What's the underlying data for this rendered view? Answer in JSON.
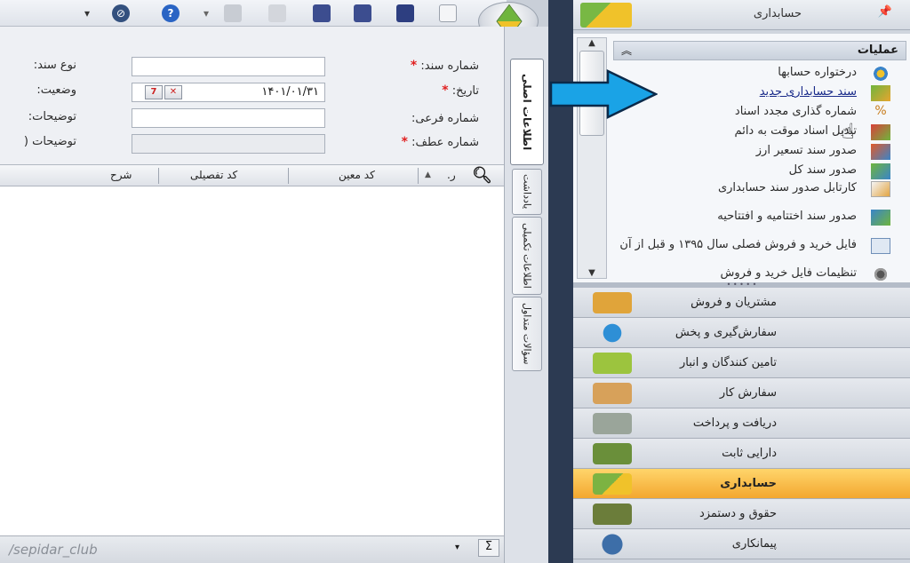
{
  "form": {
    "doc_number_label": "شماره سند:",
    "doc_type_label": "نوع سند:",
    "date_label": "تاریخ:",
    "date_value": "۱۴۰۱/۰۱/۳۱",
    "status_label": "وضعیت:",
    "sub_number_label": "شماره فرعی:",
    "desc_label": "توضیحات:",
    "ref_number_label": "شماره عطف:",
    "desc2_label": "توضیحات (",
    "calendar_icon_text": "7",
    "clear_icon_text": "✕",
    "required_mark": "*"
  },
  "grid": {
    "columns": [
      "ر.",
      "کد معین",
      "کد تفصیلی",
      "شرح"
    ],
    "sort_arrow": "▲"
  },
  "vtabs": [
    {
      "label": "اطلاعات اصلی"
    },
    {
      "label": "یادداشت"
    },
    {
      "label": "اطلاعات تکمیلی"
    },
    {
      "label": "سؤالات متداول"
    }
  ],
  "statusbar": {
    "watermark": "/sepidar_club"
  },
  "right_panel": {
    "title": "حسابداری",
    "pin": "📌",
    "operations_title": "عملیات",
    "collapse": "«",
    "operations": [
      {
        "label": "درختواره حسابها",
        "icon": "tree-icon"
      },
      {
        "label": "سند حسابداری جدید",
        "icon": "new-voucher-icon"
      },
      {
        "label": "شماره گذاری مجدد اسناد",
        "icon": "renumber-icon"
      },
      {
        "label": "تبدیل اسناد موقت به دائم",
        "icon": "convert-icon"
      },
      {
        "label": "صدور سند تسعیر ارز",
        "icon": "currency-icon"
      },
      {
        "label": "صدور سند کل",
        "icon": "gl-icon"
      },
      {
        "label": "کارتابل صدور سند حسابداری",
        "icon": "cartable-icon"
      },
      {
        "label": "صدور سند اختتامیه و افتتاحیه",
        "icon": "closing-icon"
      },
      {
        "label": "فایل خرید و فروش فصلی سال ۱۳۹۵ و قبل از آن",
        "icon": "file-icon"
      },
      {
        "label": "تنظیمات فایل خرید و فروش",
        "icon": "settings-icon"
      }
    ],
    "modules": [
      {
        "label": "مشتریان و فروش",
        "color": "#e0a43a"
      },
      {
        "label": "سفارش‌گیری و پخش",
        "color": "#2e8fd6"
      },
      {
        "label": "تامین کنندگان و انبار",
        "color": "#9cc43e"
      },
      {
        "label": "سفارش کار",
        "color": "#d7a15a"
      },
      {
        "label": "دریافت و پرداخت",
        "color": "#9aa59a"
      },
      {
        "label": "دارایی ثابت",
        "color": "#6a8f3a"
      },
      {
        "label": "حسابداری",
        "color": "#7cb342"
      },
      {
        "label": "حقوق و دستمزد",
        "color": "#6b7d3a"
      },
      {
        "label": "پیمانکاری",
        "color": "#3d6ea8"
      }
    ]
  },
  "colors": {
    "accent_arrow": "#1aa3e6",
    "active_module": "#f5b43c",
    "divider": "#2c3a52"
  }
}
